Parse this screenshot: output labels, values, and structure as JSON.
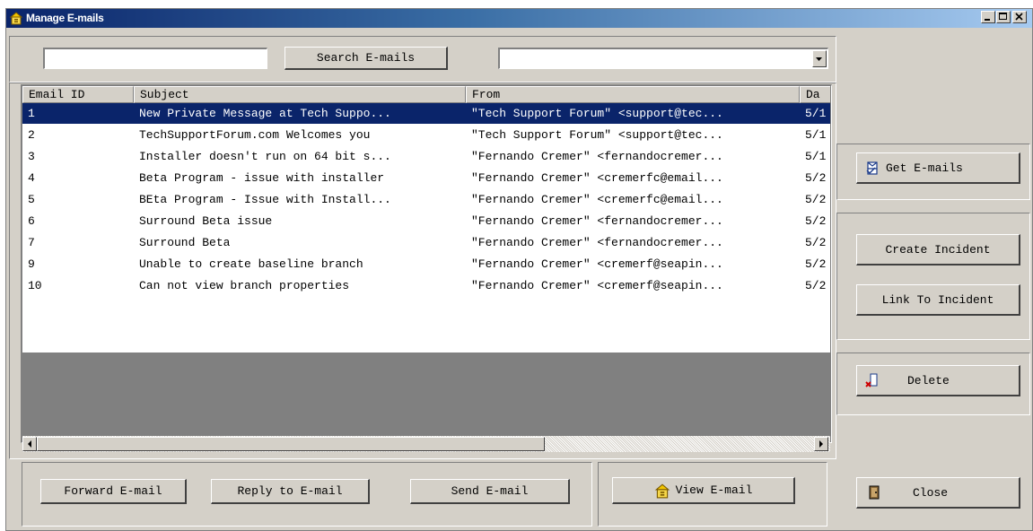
{
  "window": {
    "title": "Manage E-mails",
    "controls": [
      "minimize-button",
      "maximize-button",
      "close-window-button"
    ]
  },
  "search": {
    "value": "",
    "button_label": "Search E-mails",
    "filter_value": ""
  },
  "table": {
    "columns": [
      "Email ID",
      "Subject",
      "From",
      "Da"
    ],
    "selected_row": 0,
    "rows": [
      {
        "id": "1",
        "subject": "New Private Message at Tech Suppo...",
        "from": "\"Tech Support Forum\" <support@tec...",
        "date": "5/1"
      },
      {
        "id": "2",
        "subject": "TechSupportForum.com Welcomes you",
        "from": "\"Tech Support Forum\" <support@tec...",
        "date": "5/1"
      },
      {
        "id": "3",
        "subject": "Installer doesn't run on 64 bit s...",
        "from": "\"Fernando Cremer\" <fernandocremer...",
        "date": "5/1"
      },
      {
        "id": "4",
        "subject": "Beta Program - issue with installer",
        "from": "\"Fernando Cremer\" <cremerfc@email...",
        "date": "5/2"
      },
      {
        "id": "5",
        "subject": "BEta Program - Issue with Install...",
        "from": "\"Fernando Cremer\" <cremerfc@email...",
        "date": "5/2"
      },
      {
        "id": "6",
        "subject": "Surround Beta issue",
        "from": "\"Fernando Cremer\" <fernandocremer...",
        "date": "5/2"
      },
      {
        "id": "7",
        "subject": "Surround Beta",
        "from": "\"Fernando Cremer\" <fernandocremer...",
        "date": "5/2"
      },
      {
        "id": "9",
        "subject": "Unable to create baseline branch",
        "from": "\"Fernando Cremer\" <cremerf@seapin...",
        "date": "5/2"
      },
      {
        "id": "10",
        "subject": "Can not view branch properties",
        "from": "\"Fernando Cremer\" <cremerf@seapin...",
        "date": "5/2"
      }
    ]
  },
  "buttons": {
    "forward": "Forward E-mail",
    "reply": "Reply to E-mail",
    "send": "Send E-mail",
    "view": "View E-mail",
    "get": "Get E-mails",
    "create_incident": "Create Incident",
    "link_incident": "Link To Incident",
    "delete": "Delete",
    "close": "Close"
  },
  "icons": {
    "app": "mailbox-icon",
    "view": "mailbox-icon",
    "get": "mail-fetch-icon",
    "delete": "delete-icon",
    "close": "door-icon"
  },
  "colors": {
    "face": "#d4d0c8",
    "selection": "#0a246a",
    "title_start": "#0a246a",
    "title_end": "#a6caf0",
    "empty_area": "#808080"
  }
}
